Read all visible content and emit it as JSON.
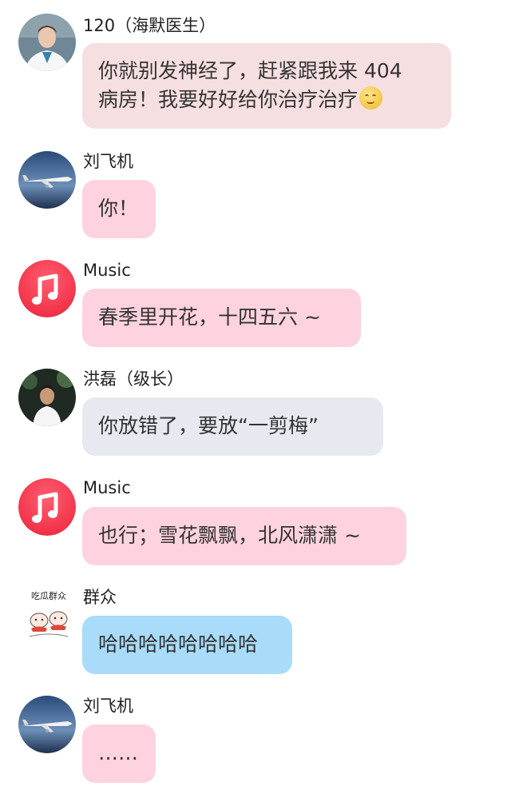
{
  "colors": {
    "bubble_pink_light": "#f6dfe1",
    "bubble_pink": "#fed3df",
    "bubble_gray": "#e6e9f0",
    "bubble_blue": "#a8dcfa",
    "music_red": "#f23449"
  },
  "messages": [
    {
      "sender": "120（海默医生）",
      "avatar": "doctor-avatar",
      "lines": [
        "你就别发神经了，赶紧跟我来 404",
        "病房！我要好好给你治疗治疗"
      ],
      "emoji": "smirk-emoji"
    },
    {
      "sender": "刘飞机",
      "avatar": "airplane-avatar",
      "lines": [
        "你！"
      ]
    },
    {
      "sender": "Music",
      "avatar": "music-app-icon",
      "lines": [
        "春季里开花，十四五六 ~"
      ]
    },
    {
      "sender": "洪磊（级长）",
      "avatar": "person-avatar",
      "lines": [
        "你放错了，要放“一剪梅”"
      ]
    },
    {
      "sender": "Music",
      "avatar": "music-app-icon",
      "lines": [
        "也行；雪花飘飘，北风潇潇 ~"
      ]
    },
    {
      "sender": "群众",
      "avatar": "melon-eaters-avatar",
      "avatar_caption": "吃瓜群众",
      "lines": [
        "哈哈哈哈哈哈哈哈"
      ]
    },
    {
      "sender": "刘飞机",
      "avatar": "airplane-avatar",
      "lines": [
        "……"
      ]
    }
  ]
}
